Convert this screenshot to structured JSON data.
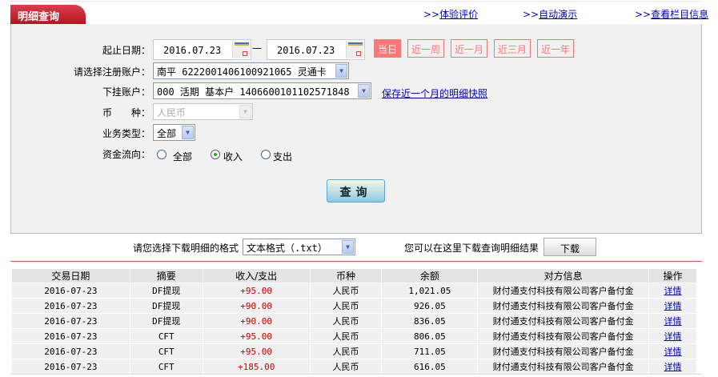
{
  "tab_title": "明细查询",
  "top_links": [
    {
      "prefix": ">>",
      "label": "体验评价"
    },
    {
      "prefix": ">>",
      "label": "自动演示"
    },
    {
      "prefix": ">>",
      "label": "查看栏目信息"
    }
  ],
  "form": {
    "date_label": "起止日期：",
    "start_date": "2016.07.23",
    "date_sep": "—",
    "end_date": "2016.07.23",
    "quick_ranges": [
      {
        "label": "当日",
        "active": true
      },
      {
        "label": "近一周"
      },
      {
        "label": "近一月"
      },
      {
        "label": "近三月"
      },
      {
        "label": "近一年"
      }
    ],
    "account_label": "请选择注册账户：",
    "account_value": "南平 6222001406100921065 灵通卡",
    "sub_account_label": "下挂账户：",
    "sub_account_value": "000 活期 基本户 1406600101102571848",
    "snapshot_link": "保存近一个月的明细快照",
    "currency_label": "币　　种：",
    "currency_value": "人民币",
    "biz_type_label": "业务类型：",
    "biz_type_value": "全部",
    "flow_label": "资金流向：",
    "flow_options": [
      {
        "label": "全部",
        "checked": false
      },
      {
        "label": "收入",
        "checked": true
      },
      {
        "label": "支出",
        "checked": false
      }
    ],
    "query_button": "查询"
  },
  "download": {
    "format_label": "请您选择下载明细的格式",
    "format_value": "文本格式（.txt）",
    "hint": "您可以在这里下载查询明细结果",
    "button": "下载"
  },
  "table": {
    "headers": [
      "交易日期",
      "摘要",
      "收入/支出",
      "币种",
      "余额",
      "对方信息",
      "操作"
    ],
    "rows": [
      [
        "2016-07-23",
        "DF提现",
        "+95.00",
        "人民币",
        "1,021.05",
        "财付通支付科技有限公司客户备付金",
        "详情"
      ],
      [
        "2016-07-23",
        "DF提现",
        "+90.00",
        "人民币",
        "926.05",
        "财付通支付科技有限公司客户备付金",
        "详情"
      ],
      [
        "2016-07-23",
        "DF提现",
        "+90.00",
        "人民币",
        "836.05",
        "财付通支付科技有限公司客户备付金",
        "详情"
      ],
      [
        "2016-07-23",
        "CFT",
        "+95.00",
        "人民币",
        "806.05",
        "财付通支付科技有限公司客户备付金",
        "详情"
      ],
      [
        "2016-07-23",
        "CFT",
        "+95.00",
        "人民币",
        "711.05",
        "财付通支付科技有限公司客户备付金",
        "详情"
      ],
      [
        "2016-07-23",
        "CFT",
        "+185.00",
        "人民币",
        "616.05",
        "财付通支付科技有限公司客户备付金",
        "详情"
      ]
    ]
  },
  "colors": {
    "tab": "#c41e2a",
    "link": "#0000cc",
    "amount": "#cc0000",
    "quick_range": "#ff7777"
  }
}
